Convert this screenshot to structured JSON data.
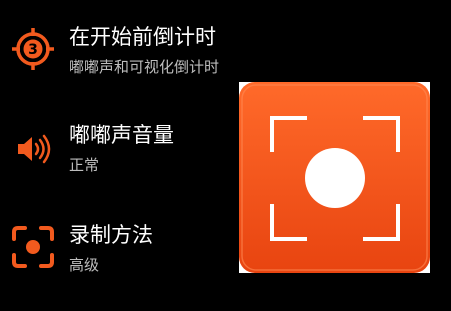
{
  "settings": {
    "items": [
      {
        "title": "在开始前倒计时",
        "subtitle": "嘟嘟声和可视化倒计时",
        "icon": "countdown-target-icon",
        "icon_text": "3"
      },
      {
        "title": "嘟嘟声音量",
        "subtitle": "正常",
        "icon": "speaker-volume-icon"
      },
      {
        "title": "录制方法",
        "subtitle": "高级",
        "icon": "record-frame-icon"
      }
    ]
  },
  "app_icon": {
    "name": "screen-recorder-app-icon"
  },
  "colors": {
    "background": "#000000",
    "accent": "#f25a1e",
    "title_text": "#ffffff",
    "subtitle_text": "#bdbdbd"
  }
}
